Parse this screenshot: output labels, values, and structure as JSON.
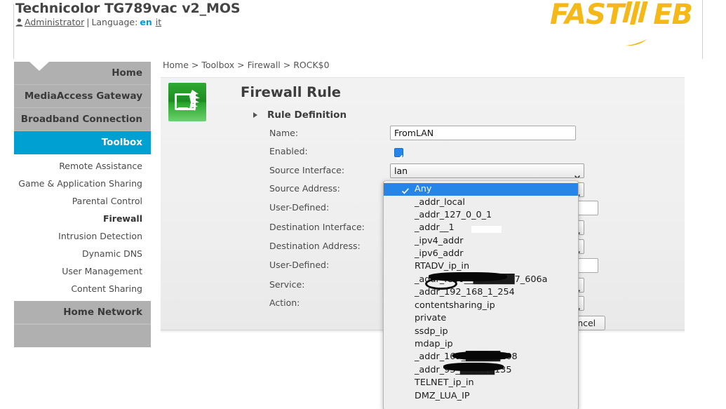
{
  "header": {
    "title": "Technicolor TG789vac v2_MOS",
    "user_icon": "person-icon",
    "user": "Administrator",
    "separator": "|",
    "language_label": "Language:",
    "lang_en": "en",
    "lang_it": "it",
    "logo_text_left": "FAST",
    "logo_text_right": "EB",
    "logo_color": "#f5b819"
  },
  "breadcrumb": "Home > Toolbox > Firewall > ROCK$0",
  "sidebar": {
    "main_items": [
      {
        "label": "Home",
        "active": false
      },
      {
        "label": "MediaAccess Gateway",
        "active": false
      },
      {
        "label": "Broadband Connection",
        "active": false
      },
      {
        "label": "Toolbox",
        "active": true
      }
    ],
    "sub_items": [
      {
        "label": "Remote Assistance",
        "current": false
      },
      {
        "label": "Game & Application Sharing",
        "current": false
      },
      {
        "label": "Parental Control",
        "current": false
      },
      {
        "label": "Firewall",
        "current": true
      },
      {
        "label": "Intrusion Detection",
        "current": false
      },
      {
        "label": "Dynamic DNS",
        "current": false
      },
      {
        "label": "User Management",
        "current": false
      },
      {
        "label": "Content Sharing",
        "current": false
      }
    ],
    "footer_item": {
      "label": "Home Network",
      "active": false
    },
    "active_color": "#00a0d2"
  },
  "content": {
    "icon": "firewall-shield-icon",
    "page_title": "Firewall Rule",
    "section_title": "Rule Definition",
    "fields": [
      {
        "label": "Name:",
        "type": "text",
        "value": "FromLAN"
      },
      {
        "label": "Enabled:",
        "type": "checkbox",
        "value": "checked"
      },
      {
        "label": "Source Interface:",
        "type": "select",
        "value": "lan"
      },
      {
        "label": "Source Address:",
        "type": "select",
        "value": "Any"
      },
      {
        "label": "User-Defined:",
        "type": "text",
        "value": ""
      },
      {
        "label": "Destination Interface:",
        "type": "select",
        "value": ""
      },
      {
        "label": "Destination Address:",
        "type": "select",
        "value": ""
      },
      {
        "label": "User-Defined:",
        "type": "text",
        "value": ""
      },
      {
        "label": "Service:",
        "type": "select",
        "value": ""
      },
      {
        "label": "Action:",
        "type": "select",
        "value": ""
      }
    ],
    "cancel_button": "Cancel"
  },
  "dropdown": {
    "name": "source-address-options",
    "selected": "Any",
    "selected_color": "#2585e8",
    "options": [
      "Any",
      "_addr_local",
      "_addr_127_0_0_1",
      "_addr__1",
      "_ipv4_addr",
      "_ipv6_addr",
      "RTADV_ip_in",
      "_addr_fe80__██████7_606a",
      "_addr_192_168_1_254",
      "contentsharing_ip",
      "private",
      "ssdp_ip",
      "mdap_ip",
      "_addr_169_█████208",
      "_addr_93_█████135",
      "TELNET_ip_in",
      "DMZ_LUA_IP"
    ]
  }
}
